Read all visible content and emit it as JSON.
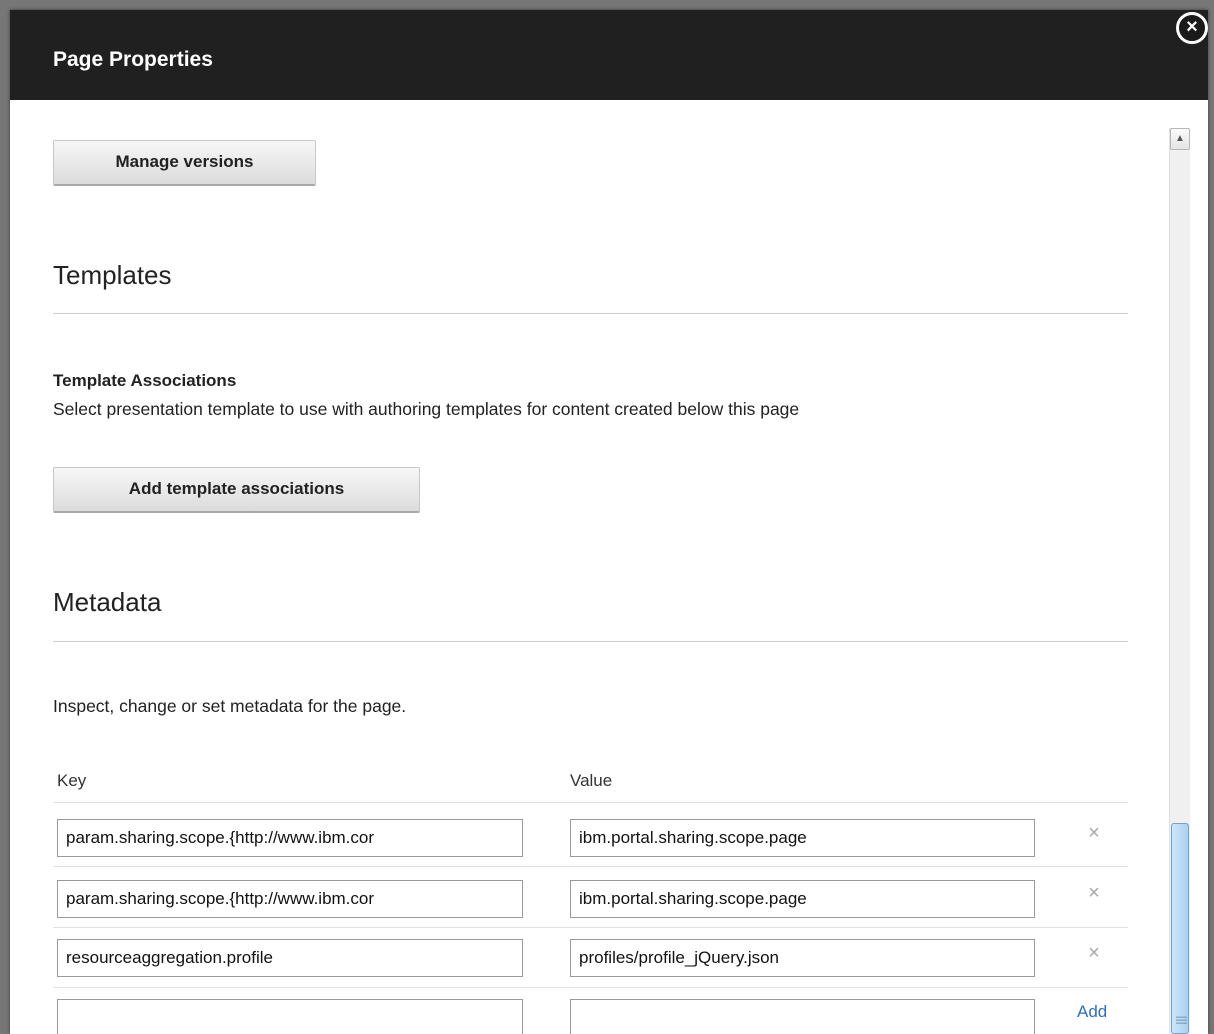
{
  "dialog": {
    "title": "Page Properties",
    "close_label": "×"
  },
  "buttons": {
    "manage_versions": "Manage versions",
    "add_template_associations": "Add template associations"
  },
  "templates": {
    "title": "Templates",
    "subheading": "Template Associations",
    "description": "Select presentation template to use with authoring templates for content created below this page"
  },
  "metadata": {
    "title": "Metadata",
    "description": "Inspect, change or set metadata for the page.",
    "col_key": "Key",
    "col_value": "Value",
    "rows": [
      {
        "key": "param.sharing.scope.{http://www.ibm.cor",
        "value": "ibm.portal.sharing.scope.page",
        "remove": "×"
      },
      {
        "key": "param.sharing.scope.{http://www.ibm.cor",
        "value": "ibm.portal.sharing.scope.page",
        "remove": "×"
      },
      {
        "key": "resourceaggregation.profile",
        "value": "profiles/profile_jQuery.json",
        "remove": "×"
      }
    ],
    "new_row": {
      "key": "",
      "value": ""
    },
    "add_label": "Add"
  },
  "icons": {
    "close": "close-icon",
    "remove": "remove-icon",
    "scroll_up": "chevron-up-icon",
    "grip": "grip-icon"
  }
}
